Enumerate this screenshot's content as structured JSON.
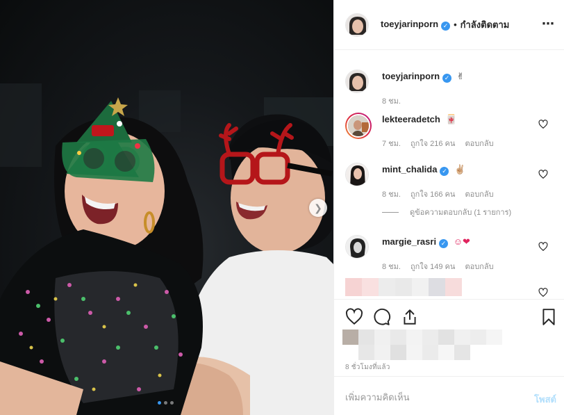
{
  "post": {
    "author": "toeyjarinporn",
    "separator": "•",
    "follow_status": "กำลังติดตาม",
    "more_icon": "more-dots-icon"
  },
  "caption": {
    "username": "toeyjarinporn",
    "text": "✌",
    "time": "8 ชม."
  },
  "comments": [
    {
      "username": "lekteeradetch",
      "text": "🀄",
      "time": "7 ชม.",
      "likes": "ถูกใจ 216 คน",
      "reply": "ตอบกลับ"
    },
    {
      "username": "mint_chalida",
      "text": "✌🏼",
      "time": "8 ชม.",
      "likes": "ถูกใจ 166 คน",
      "reply": "ตอบกลับ",
      "view_replies": "ดูข้อความตอบกลับ (1 รายการ)"
    },
    {
      "username": "margie_rasri",
      "text": "☺❤",
      "time": "8 ชม.",
      "likes": "ถูกใจ 149 คน",
      "reply": "ตอบกลับ"
    }
  ],
  "actions": {
    "like_icon": "heart-icon",
    "comment_icon": "comment-bubble-icon",
    "share_icon": "share-icon",
    "save_icon": "bookmark-icon"
  },
  "timestamp": "8 ชั่วโมงที่แล้ว",
  "add_comment": {
    "placeholder": "เพิ่มความคิดเห็น",
    "post_label": "โพสต์"
  },
  "carousel": {
    "slides": 3,
    "current": 1
  },
  "colors": {
    "verified": "#3897f0",
    "post_disabled": "#b2dffc",
    "text_muted": "#8e8e8e"
  }
}
